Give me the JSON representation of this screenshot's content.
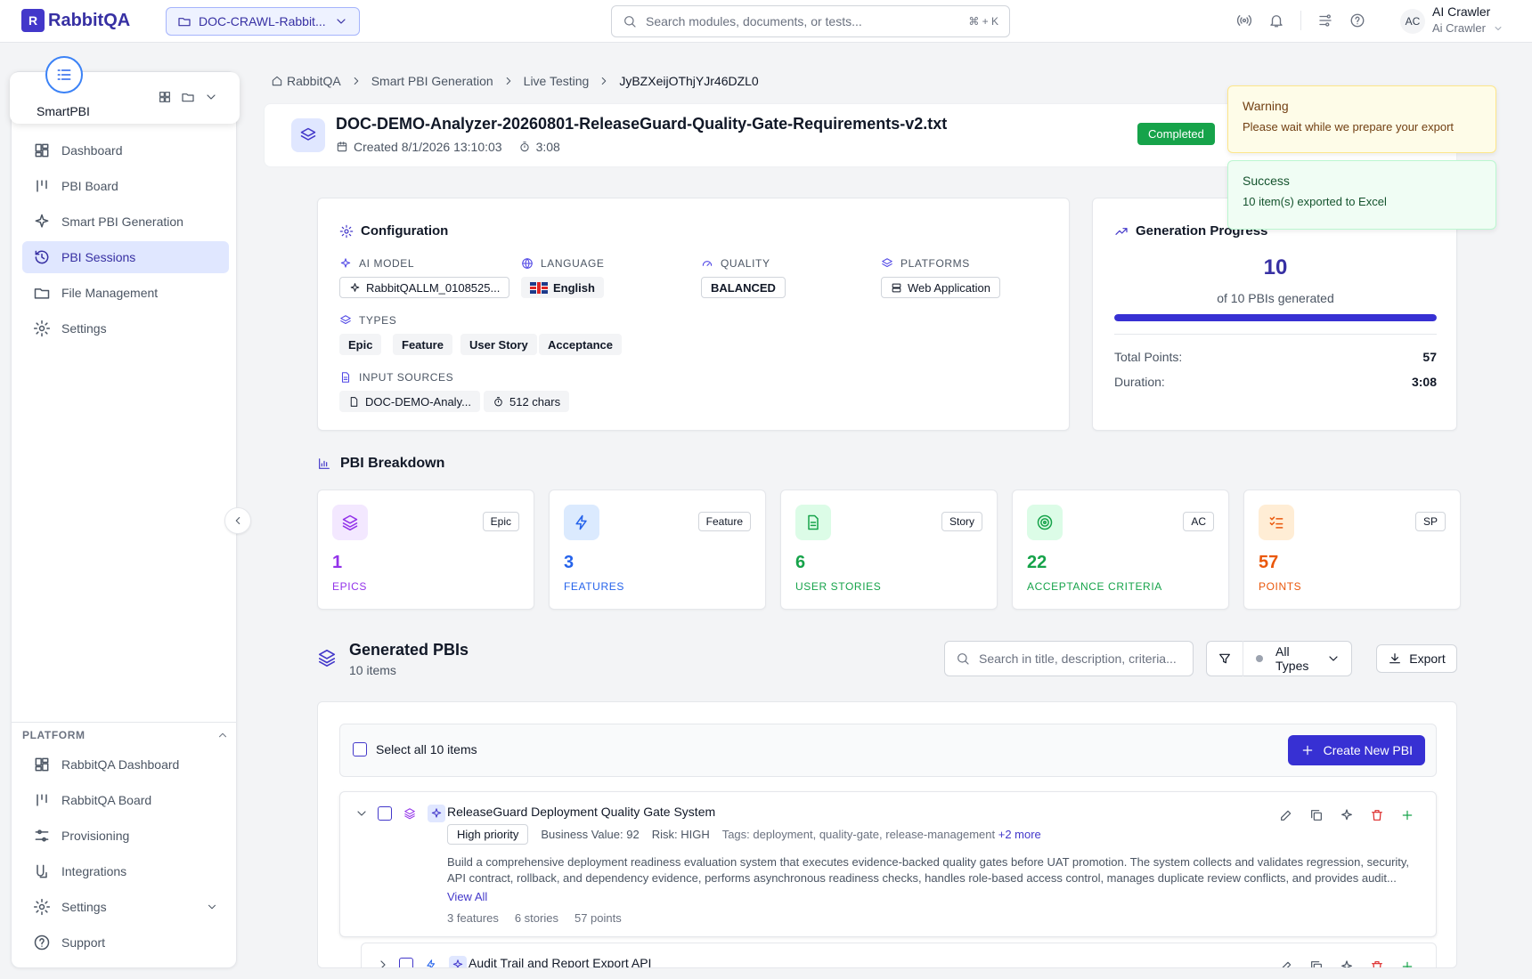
{
  "app": {
    "logo_text": "RabbitQA",
    "project": "DOC-CRAWL-Rabbit...",
    "search_placeholder": "Search modules, documents, or tests...",
    "search_shortcut": "⌘ + K",
    "user_initials": "AC",
    "user_name": "AI Crawler",
    "user_sub": "Ai Crawler"
  },
  "sidebar": {
    "brand": "SmartPBI",
    "items": [
      {
        "label": "Dashboard",
        "icon": "dashboard-icon"
      },
      {
        "label": "PBI Board",
        "icon": "board-icon"
      },
      {
        "label": "Smart PBI Generation",
        "icon": "sparkle-icon"
      },
      {
        "label": "PBI Sessions",
        "icon": "history-icon",
        "active": true
      },
      {
        "label": "File Management",
        "icon": "folder-icon"
      },
      {
        "label": "Settings",
        "icon": "gear-icon"
      }
    ],
    "platform_title": "PLATFORM",
    "platform_items": [
      {
        "label": "RabbitQA Dashboard",
        "icon": "dashboard-icon"
      },
      {
        "label": "RabbitQA Board",
        "icon": "board-icon"
      },
      {
        "label": "Provisioning",
        "icon": "sliders-icon"
      },
      {
        "label": "Integrations",
        "icon": "integrations-icon"
      },
      {
        "label": "Settings",
        "icon": "gear-icon"
      },
      {
        "label": "Support",
        "icon": "help-icon"
      }
    ]
  },
  "breadcrumb": [
    "RabbitQA",
    "Smart PBI Generation",
    "Live Testing",
    "JyBZXeijOThjYJr46DZL0"
  ],
  "session": {
    "title": "DOC-DEMO-Analyzer-20260801-ReleaseGuard-Quality-Gate-Requirements-v2.txt",
    "created": "Created 8/1/2026  13:10:03",
    "duration": "3:08",
    "status": "Completed"
  },
  "toasts": {
    "warning_title": "Warning",
    "warning_text": "Please wait while we prepare your export",
    "success_title": "Success",
    "success_text": "10 item(s) exported to Excel"
  },
  "config": {
    "title": "Configuration",
    "ai_model_label": "AI MODEL",
    "ai_model": "RabbitQALLM_0108525...",
    "language_label": "LANGUAGE",
    "language": "English",
    "quality_label": "QUALITY",
    "quality": "BALANCED",
    "platforms_label": "PLATFORMS",
    "platform": "Web Application",
    "types_label": "TYPES",
    "types": [
      "Epic",
      "Feature",
      "User Story",
      "Acceptance"
    ],
    "input_label": "INPUT SOURCES",
    "input_file": "DOC-DEMO-Analy...",
    "input_chars": "512 chars"
  },
  "progress": {
    "title": "Generation Progress",
    "generated": "10",
    "subtitle": "of 10 PBIs generated",
    "fraction": 1.0,
    "total_points_label": "Total Points:",
    "total_points": "57",
    "duration_label": "Duration:",
    "duration": "3:08"
  },
  "breakdown": {
    "title": "PBI Breakdown",
    "cards": [
      {
        "tag": "Epic",
        "value": "1",
        "label": "EPICS",
        "color": "#9333ea",
        "bg": "#f3e8ff",
        "icon": "layers-icon"
      },
      {
        "tag": "Feature",
        "value": "3",
        "label": "FEATURES",
        "color": "#2563eb",
        "bg": "#dbeafe",
        "icon": "bolt-icon"
      },
      {
        "tag": "Story",
        "value": "6",
        "label": "USER STORIES",
        "color": "#16a34a",
        "bg": "#dcfce7",
        "icon": "document-icon"
      },
      {
        "tag": "AC",
        "value": "22",
        "label": "ACCEPTANCE CRITERIA",
        "color": "#16a34a",
        "bg": "#dcfce7",
        "icon": "target-icon"
      },
      {
        "tag": "SP",
        "value": "57",
        "label": "POINTS",
        "color": "#ea580c",
        "bg": "#ffedd5",
        "icon": "checklist-icon"
      }
    ]
  },
  "generated": {
    "title": "Generated PBIs",
    "count": "10 items",
    "search_placeholder": "Search in title, description, criteria...",
    "filter": "All Types",
    "export": "Export",
    "select_all": "Select all 10 items",
    "create": "Create New PBI",
    "rows": [
      {
        "title": "ReleaseGuard Deployment Quality Gate System",
        "priority": "High priority",
        "business_value": "Business Value: 92",
        "risk": "Risk: HIGH",
        "tags": "Tags: deployment, quality-gate, release-management",
        "more": "+2 more",
        "description": "Build a comprehensive deployment readiness evaluation system that executes evidence-backed quality gates before UAT promotion. The system collects and validates regression, security, API contract, rollback, and dependency evidence, performs asynchronous readiness checks, handles role-based access control, manages duplicate review conflicts, and provides audit...",
        "view_all": "View All",
        "features": "3 features",
        "stories": "6 stories",
        "points": "57 points"
      },
      {
        "title": "Audit Trail and Report Export API"
      }
    ]
  }
}
